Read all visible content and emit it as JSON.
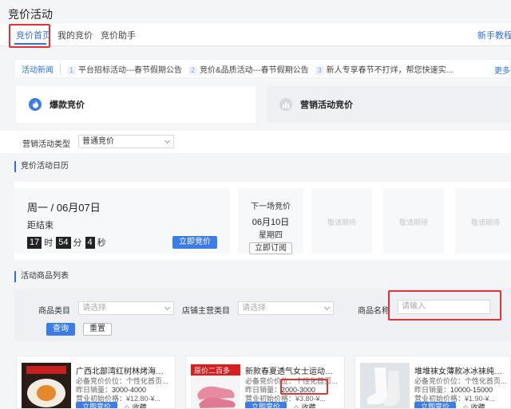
{
  "page_title": "竞价活动",
  "tabs": [
    {
      "label": "竞价首页",
      "active": true
    },
    {
      "label": "我的竞价",
      "active": false
    },
    {
      "label": "竞价助手",
      "active": false
    }
  ],
  "tab_right_link": "新手教程",
  "news": {
    "title": "活动新闻",
    "items": [
      {
        "num": "1",
        "text": "平台招标活动---春节假期公告"
      },
      {
        "num": "2",
        "text": "竞价&品质活动---春节假期公告"
      },
      {
        "num": "3",
        "text": "新人专享春节不打烊，帮您快速实..."
      }
    ],
    "more": "更多"
  },
  "hero": {
    "left_label": "爆款竞价",
    "right_label": "营销活动竞价"
  },
  "activity_filter": {
    "label": "营销活动类型",
    "value": "普通竞价"
  },
  "calendar": {
    "section_title": "竞价活动日历",
    "current": {
      "date": "周一 / 06月07日",
      "sub": "距结束",
      "days": "17",
      "days_unit": "时",
      "hours": "54",
      "hours_unit": "分",
      "minutes": "4",
      "minutes_unit": "秒",
      "button": "立即竞价"
    },
    "next": {
      "title": "下一场竞价",
      "date": "06月10日",
      "weekday": "星期四",
      "button": "立即订阅"
    },
    "placeholders": [
      "敬请期待",
      "敬请期待",
      "敬请期待"
    ]
  },
  "goods_list": {
    "section_title": "活动商品列表",
    "category_label": "商品类目",
    "category_placeholder": "请选择",
    "store_label": "店铺主营类目",
    "store_placeholder": "请选择",
    "name_label": "商品名称",
    "name_placeholder": "请输入",
    "query_button": "查询",
    "reset_button": "重置"
  },
  "goods": [
    {
      "title": "广西北部湾红树林烤海鸭...",
      "line1": "必备竞价价位：个性化首页...",
      "sales_label": "昨日销量：",
      "sales": "3000-4000",
      "price_line": "营业初始价格：¥12.80-¥...",
      "button": "立即竞价",
      "fav": "收藏"
    },
    {
      "title": "新款春夏透气女士运动鞋...",
      "line1": "必备竞价价位：个性化首页...",
      "sales_label": "昨日销量：",
      "sales": "2000-3000",
      "price_line": "营业初始价格：¥3.80-¥...",
      "button": "立即竞价",
      "fav": "收藏",
      "img_text": "原价二百多"
    },
    {
      "title": "堆堆袜女薄款冰冰袜纯白...",
      "line1": "必备竞价价位：个性化首页...",
      "sales_label": "昨日销量：",
      "sales": "10000-15000",
      "price_line": "营业初始价格：¥1.90-¥...",
      "button": "立即竞价",
      "fav": "收藏"
    }
  ],
  "colors": {
    "accent": "#2f6fe0",
    "button": "#3c7ce6",
    "highlight_box": "#e23333"
  }
}
